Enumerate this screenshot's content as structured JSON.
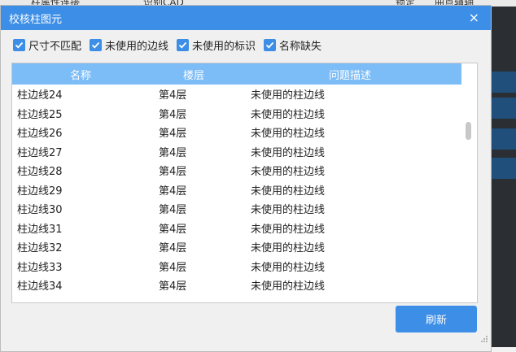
{
  "background_toolbar": {
    "items": [
      "柱属性连接",
      "识别CAD",
      "锁定",
      "曲点辅轴"
    ]
  },
  "dialog": {
    "title": "校核柱图元",
    "close_symbol": "×",
    "filters": [
      {
        "label": "尺寸不匹配",
        "checked": true
      },
      {
        "label": "未使用的边线",
        "checked": true
      },
      {
        "label": "未使用的标识",
        "checked": true
      },
      {
        "label": "名称缺失",
        "checked": true
      }
    ],
    "table": {
      "headers": [
        "名称",
        "楼层",
        "问题描述"
      ],
      "rows": [
        [
          "柱边线24",
          "第4层",
          "未使用的柱边线"
        ],
        [
          "柱边线25",
          "第4层",
          "未使用的柱边线"
        ],
        [
          "柱边线26",
          "第4层",
          "未使用的柱边线"
        ],
        [
          "柱边线27",
          "第4层",
          "未使用的柱边线"
        ],
        [
          "柱边线28",
          "第4层",
          "未使用的柱边线"
        ],
        [
          "柱边线29",
          "第4层",
          "未使用的柱边线"
        ],
        [
          "柱边线30",
          "第4层",
          "未使用的柱边线"
        ],
        [
          "柱边线31",
          "第4层",
          "未使用的柱边线"
        ],
        [
          "柱边线32",
          "第4层",
          "未使用的柱边线"
        ],
        [
          "柱边线33",
          "第4层",
          "未使用的柱边线"
        ],
        [
          "柱边线34",
          "第4层",
          "未使用的柱边线"
        ]
      ]
    },
    "refresh_label": "刷新"
  },
  "colors": {
    "accent": "#3d8ee6",
    "header_bg": "#7cbcf7"
  }
}
